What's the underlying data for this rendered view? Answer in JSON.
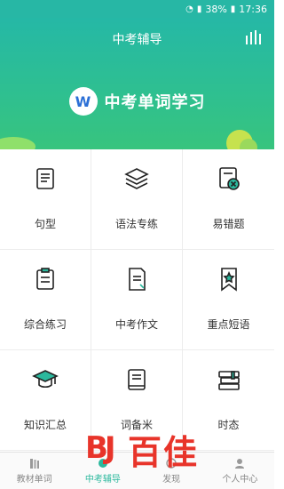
{
  "status_bar": {
    "battery": "38%",
    "time": "17:36"
  },
  "header": {
    "title": "中考辅导",
    "menu_icon": "stats-bars-icon"
  },
  "hero": {
    "logo_letter": "W",
    "title": "中考单词学习"
  },
  "grid": [
    {
      "label": "句型",
      "icon": "scroll-icon"
    },
    {
      "label": "语法专练",
      "icon": "layers-icon"
    },
    {
      "label": "易错题",
      "icon": "mistake-card-icon"
    },
    {
      "label": "综合练习",
      "icon": "clipboard-icon"
    },
    {
      "label": "中考作文",
      "icon": "document-icon"
    },
    {
      "label": "重点短语",
      "icon": "bookmark-star-icon"
    },
    {
      "label": "知识汇总",
      "icon": "graduation-cap-icon"
    },
    {
      "label": "词备米",
      "icon": "book-icon"
    },
    {
      "label": "时态",
      "icon": "books-stack-icon"
    }
  ],
  "tabbar": [
    {
      "label": "教材单词",
      "active": false
    },
    {
      "label": "中考辅导",
      "active": true
    },
    {
      "label": "发现",
      "active": false
    },
    {
      "label": "个人中心",
      "active": false
    }
  ],
  "watermark": {
    "text": "百佳"
  },
  "colors": {
    "accent": "#2bb89d",
    "header_top": "#25b8a6",
    "watermark": "#e8342a"
  }
}
